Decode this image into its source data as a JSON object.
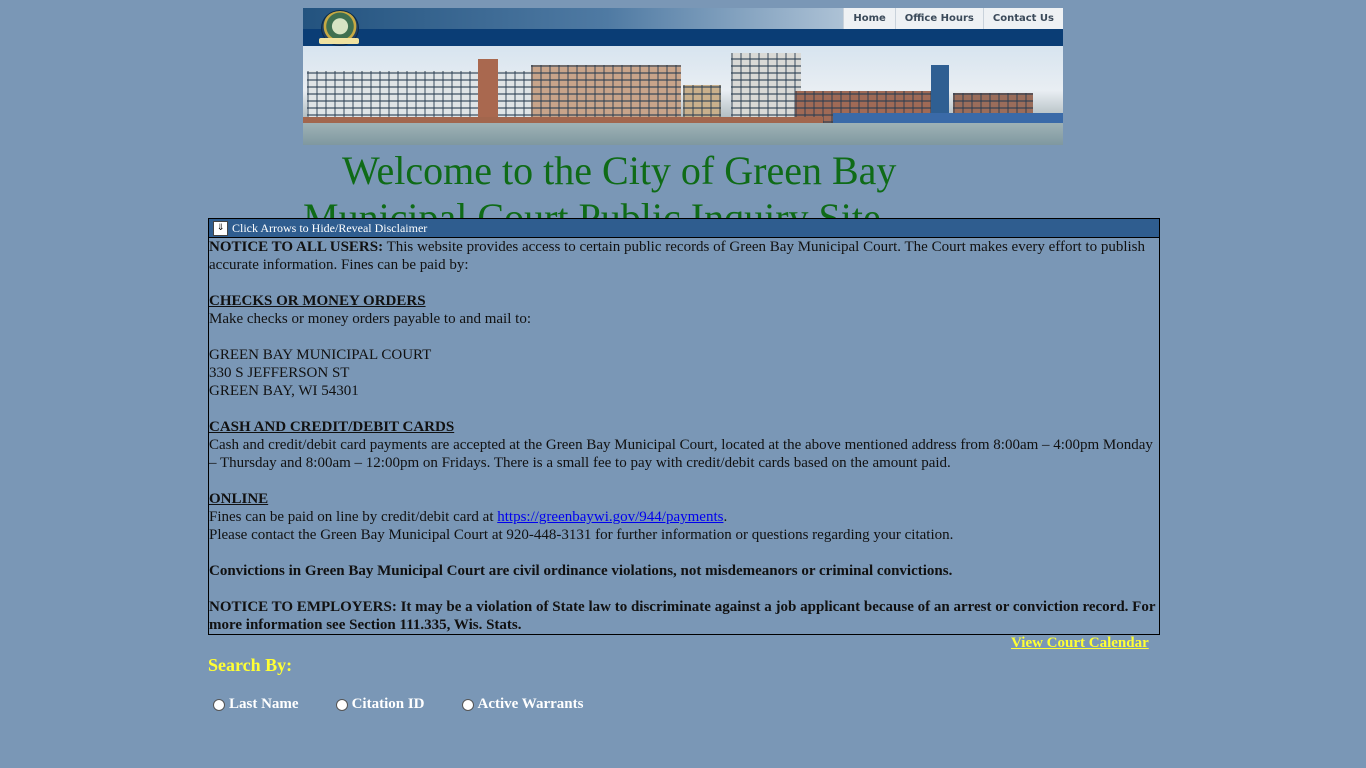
{
  "header": {
    "nav": [
      "Home",
      "Office Hours",
      "Contact Us"
    ],
    "welcome_line1": "Welcome to the City of Green Bay",
    "welcome_line2": "Municipal Court Public Inquiry Site"
  },
  "disclaimer": {
    "toggle_label": "Click Arrows to Hide/Reveal Disclaimer",
    "notice_label": "NOTICE TO ALL USERS:",
    "notice_text": " This website provides access to certain public records of Green Bay Municipal Court. The Court makes every effort to publish accurate information. Fines can be paid by:",
    "checks_heading": "CHECKS OR MONEY ORDERS",
    "checks_text": "Make checks or money orders payable to and mail to:",
    "address": [
      "GREEN BAY MUNICIPAL COURT",
      "330 S JEFFERSON ST",
      "GREEN BAY, WI 54301"
    ],
    "cash_heading": "CASH AND CREDIT/DEBIT CARDS",
    "cash_text": "Cash and credit/debit card payments are accepted at the Green Bay Municipal Court, located at the above mentioned address from 8:00am – 4:00pm Monday – Thursday and 8:00am – 12:00pm on Fridays. There is a small fee to pay with credit/debit cards based on the amount paid.",
    "online_heading": "ONLINE",
    "online_text": "Fines can be paid on line by credit/debit card at ",
    "online_link": "https://greenbaywi.gov/944/payments",
    "online_after": ".",
    "contact_text": "Please contact the Green Bay Municipal Court at 920-448-3131 for further information or questions regarding your citation.",
    "convictions_text": "Convictions in Green Bay Municipal Court are civil ordinance violations, not misdemeanors or criminal convictions.",
    "employers_text": "NOTICE TO EMPLOYERS:  It may be a violation of State law to discriminate against a job applicant because of an arrest or conviction record. For more information see Section 111.335, Wis. Stats."
  },
  "calendar_link": "View Court Calendar",
  "search": {
    "label": "Search By:",
    "options": [
      "Last Name",
      "Citation ID",
      "Active Warrants"
    ]
  },
  "colors": {
    "background": "#7a97b6",
    "welcome_text": "#0f6b17",
    "highlight_yellow": "#ffff33",
    "disclaimer_header": "#2f5d8f"
  }
}
